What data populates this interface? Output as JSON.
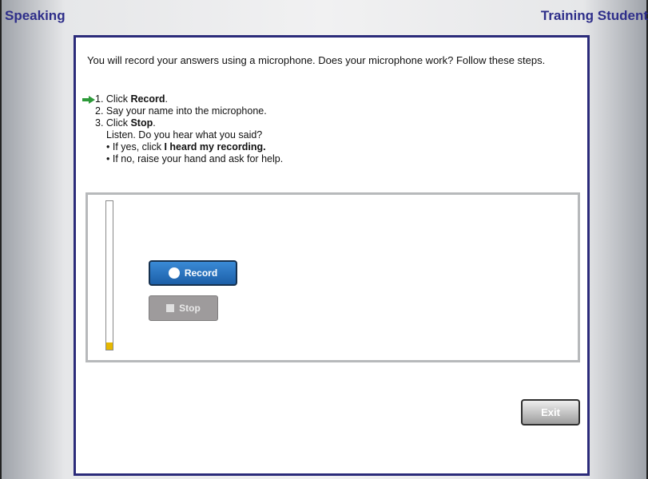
{
  "header": {
    "section_title": "Speaking",
    "user_name": "Training Student"
  },
  "instructions": {
    "intro": "You will record your answers using a microphone. Does your microphone work? Follow these steps.",
    "current_step_indicator": "green-arrow-icon",
    "step1_prefix": "1. Click ",
    "step1_bold": "Record",
    "step1_suffix": ".",
    "step2": "2. Say your name into the microphone.",
    "step3_prefix": "3. Click ",
    "step3_bold": "Stop",
    "step3_suffix": ".",
    "listen": "Listen. Do you hear what you said?",
    "if_yes_prefix": "• If yes, click ",
    "if_yes_bold": "I heard my recording.",
    "if_no": "• If no, raise your hand and ask for help."
  },
  "recorder": {
    "mic_level_fraction": 0.05,
    "record_label": "Record",
    "record_icon": "record-dot-icon",
    "stop_label": "Stop",
    "stop_icon": "stop-square-icon",
    "stop_enabled": false
  },
  "footer": {
    "exit_label": "Exit"
  },
  "colors": {
    "header_text": "#2e2e8a",
    "panel_border": "#2b2b7a",
    "record_button": "#2a72c2",
    "stop_button_disabled": "#9e9b9c",
    "mic_level": "#e6b800",
    "arrow": "#2e9a3a"
  }
}
